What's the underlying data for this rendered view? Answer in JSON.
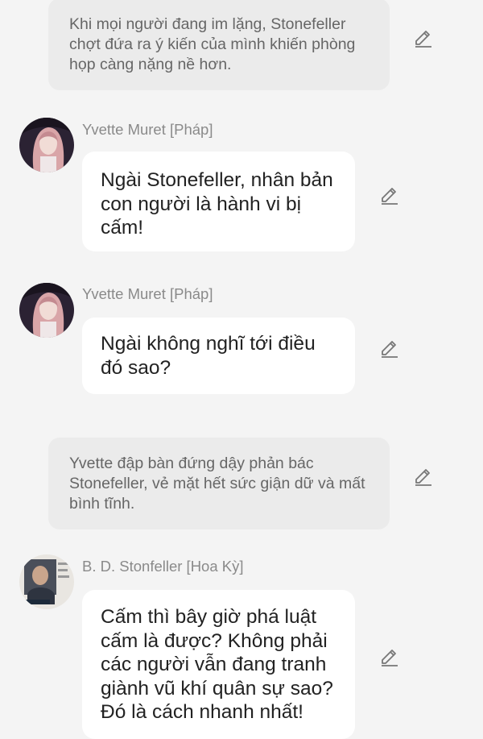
{
  "messages": [
    {
      "type": "narration",
      "text": "Khi mọi người đang im lặng, Stonefeller chợt đứa ra ý kiến của mình khiến phòng họp càng nặng nề hơn."
    },
    {
      "type": "dialogue",
      "speaker": "Yvette Muret [Pháp]",
      "text": "Ngài Stonefeller, nhân bản con người là hành vi bị cấm!"
    },
    {
      "type": "dialogue",
      "speaker": "Yvette Muret [Pháp]",
      "text": "Ngài không nghĩ tới điều đó sao?"
    },
    {
      "type": "narration",
      "text": "Yvette đập bàn đứng dậy phản bác Stonefeller, vẻ mặt hết sức giận dữ và mất bình tĩnh."
    },
    {
      "type": "dialogue",
      "speaker": "B. D. Stonfeller [Hoa Kỳ]",
      "text": "Cấm thì bây giờ phá luật cấm là được? Không phải các người vẫn đang tranh giành vũ khí quân sự sao? Đó là cách nhanh nhất!"
    }
  ],
  "icons": {
    "edit": "pencil-edit-icon",
    "avatar": "character-avatar-icon"
  },
  "colors": {
    "background": "#f4f4f4",
    "narration_bg": "#ebebeb",
    "bubble_bg": "#ffffff",
    "speaker": "#8a8a8a"
  }
}
